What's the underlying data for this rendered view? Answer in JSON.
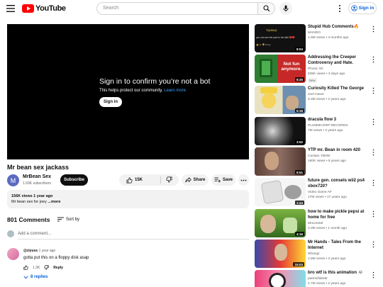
{
  "header": {
    "logo_text": "YouTube",
    "search_placeholder": "Search",
    "sign_in_label": "Sign in"
  },
  "player": {
    "message_title": "Sign in to confirm you’re not a bot",
    "message_sub": "This helps protect our community.",
    "learn_more": "Learn more",
    "sign_in_button": "Sign in"
  },
  "video": {
    "title": "Mr bean sex jackass",
    "channel_initial": "M",
    "channel_name": "MrBean Sex",
    "subscribers": "1.93K subscribers",
    "subscribe_label": "Subscribe",
    "likes": "15K",
    "share_label": "Share",
    "save_label": "Save",
    "views_date": "156K views  1 year ago",
    "description": "Mr bean sex for joey",
    "more_label": "...more"
  },
  "comments": {
    "count_label": "801 Comments",
    "sort_label": "Sort by",
    "add_placeholder": "Add a comment...",
    "items": [
      {
        "user": "@ziyuss",
        "time": "1 year ago",
        "text": "gotta put this on a floppy disk asap",
        "likes": "1.3K",
        "reply_label": "Reply",
        "replies_label": "8 replies"
      }
    ]
  },
  "sidebar": {
    "items": [
      {
        "title": "Stupid Hub Comments🔥",
        "channel": "MANDO",
        "meta": "1.9M views • 4 months ago",
        "duration": "8:04",
        "thumb_text": ""
      },
      {
        "title": "Addressing the Creeper Controversy and Hate.",
        "channel": "Phonic 9C",
        "meta": "835K views • 3 days ago",
        "duration": "8:25",
        "thumb_text": "Not fun anymore.",
        "badge": "New"
      },
      {
        "title": "Curiosity Killed The George",
        "channel": "Joel Haver",
        "meta": "3.3M views • 2 years ago",
        "duration": "5:18",
        "thumb_text": ""
      },
      {
        "title": "dracula flow 3",
        "channel": "PLUMMCORP RECORDS",
        "meta": "7M views • 2 years ago",
        "duration": "3:52",
        "thumb_text": ""
      },
      {
        "title": "YTP mr.  Bean in room 420",
        "channel": "Cariiam YBIIW",
        "meta": "180K views • 8 years ago",
        "duration": "6:51",
        "thumb_text": ""
      },
      {
        "title": "future gen. consels wii2 ps4 xbox720?",
        "channel": "Video Game AF",
        "meta": "17M views • 17 years ago",
        "duration": "1:44",
        "thumb_text": ""
      },
      {
        "title": "how to make pickle  pepsi at home  for free",
        "channel": "MrLimetal",
        "meta": "3.3M views • 1 month ago",
        "duration": "4:16",
        "thumb_text": ""
      },
      {
        "title": "Mr Hands - Tales From the Internet",
        "channel": "Whang!",
        "meta": "1.8M views • 3 years ago",
        "duration": "15:03",
        "thumb_text": ""
      },
      {
        "title": "bro wtf is this animation 💀",
        "channel": "patmeifabs9r",
        "meta": "4.7M views • 2 years ago",
        "duration": "",
        "thumb_text": ""
      }
    ]
  },
  "colors": {
    "brand_red": "#ff0000",
    "link_blue": "#065fd4",
    "player_bg": "#000000"
  }
}
